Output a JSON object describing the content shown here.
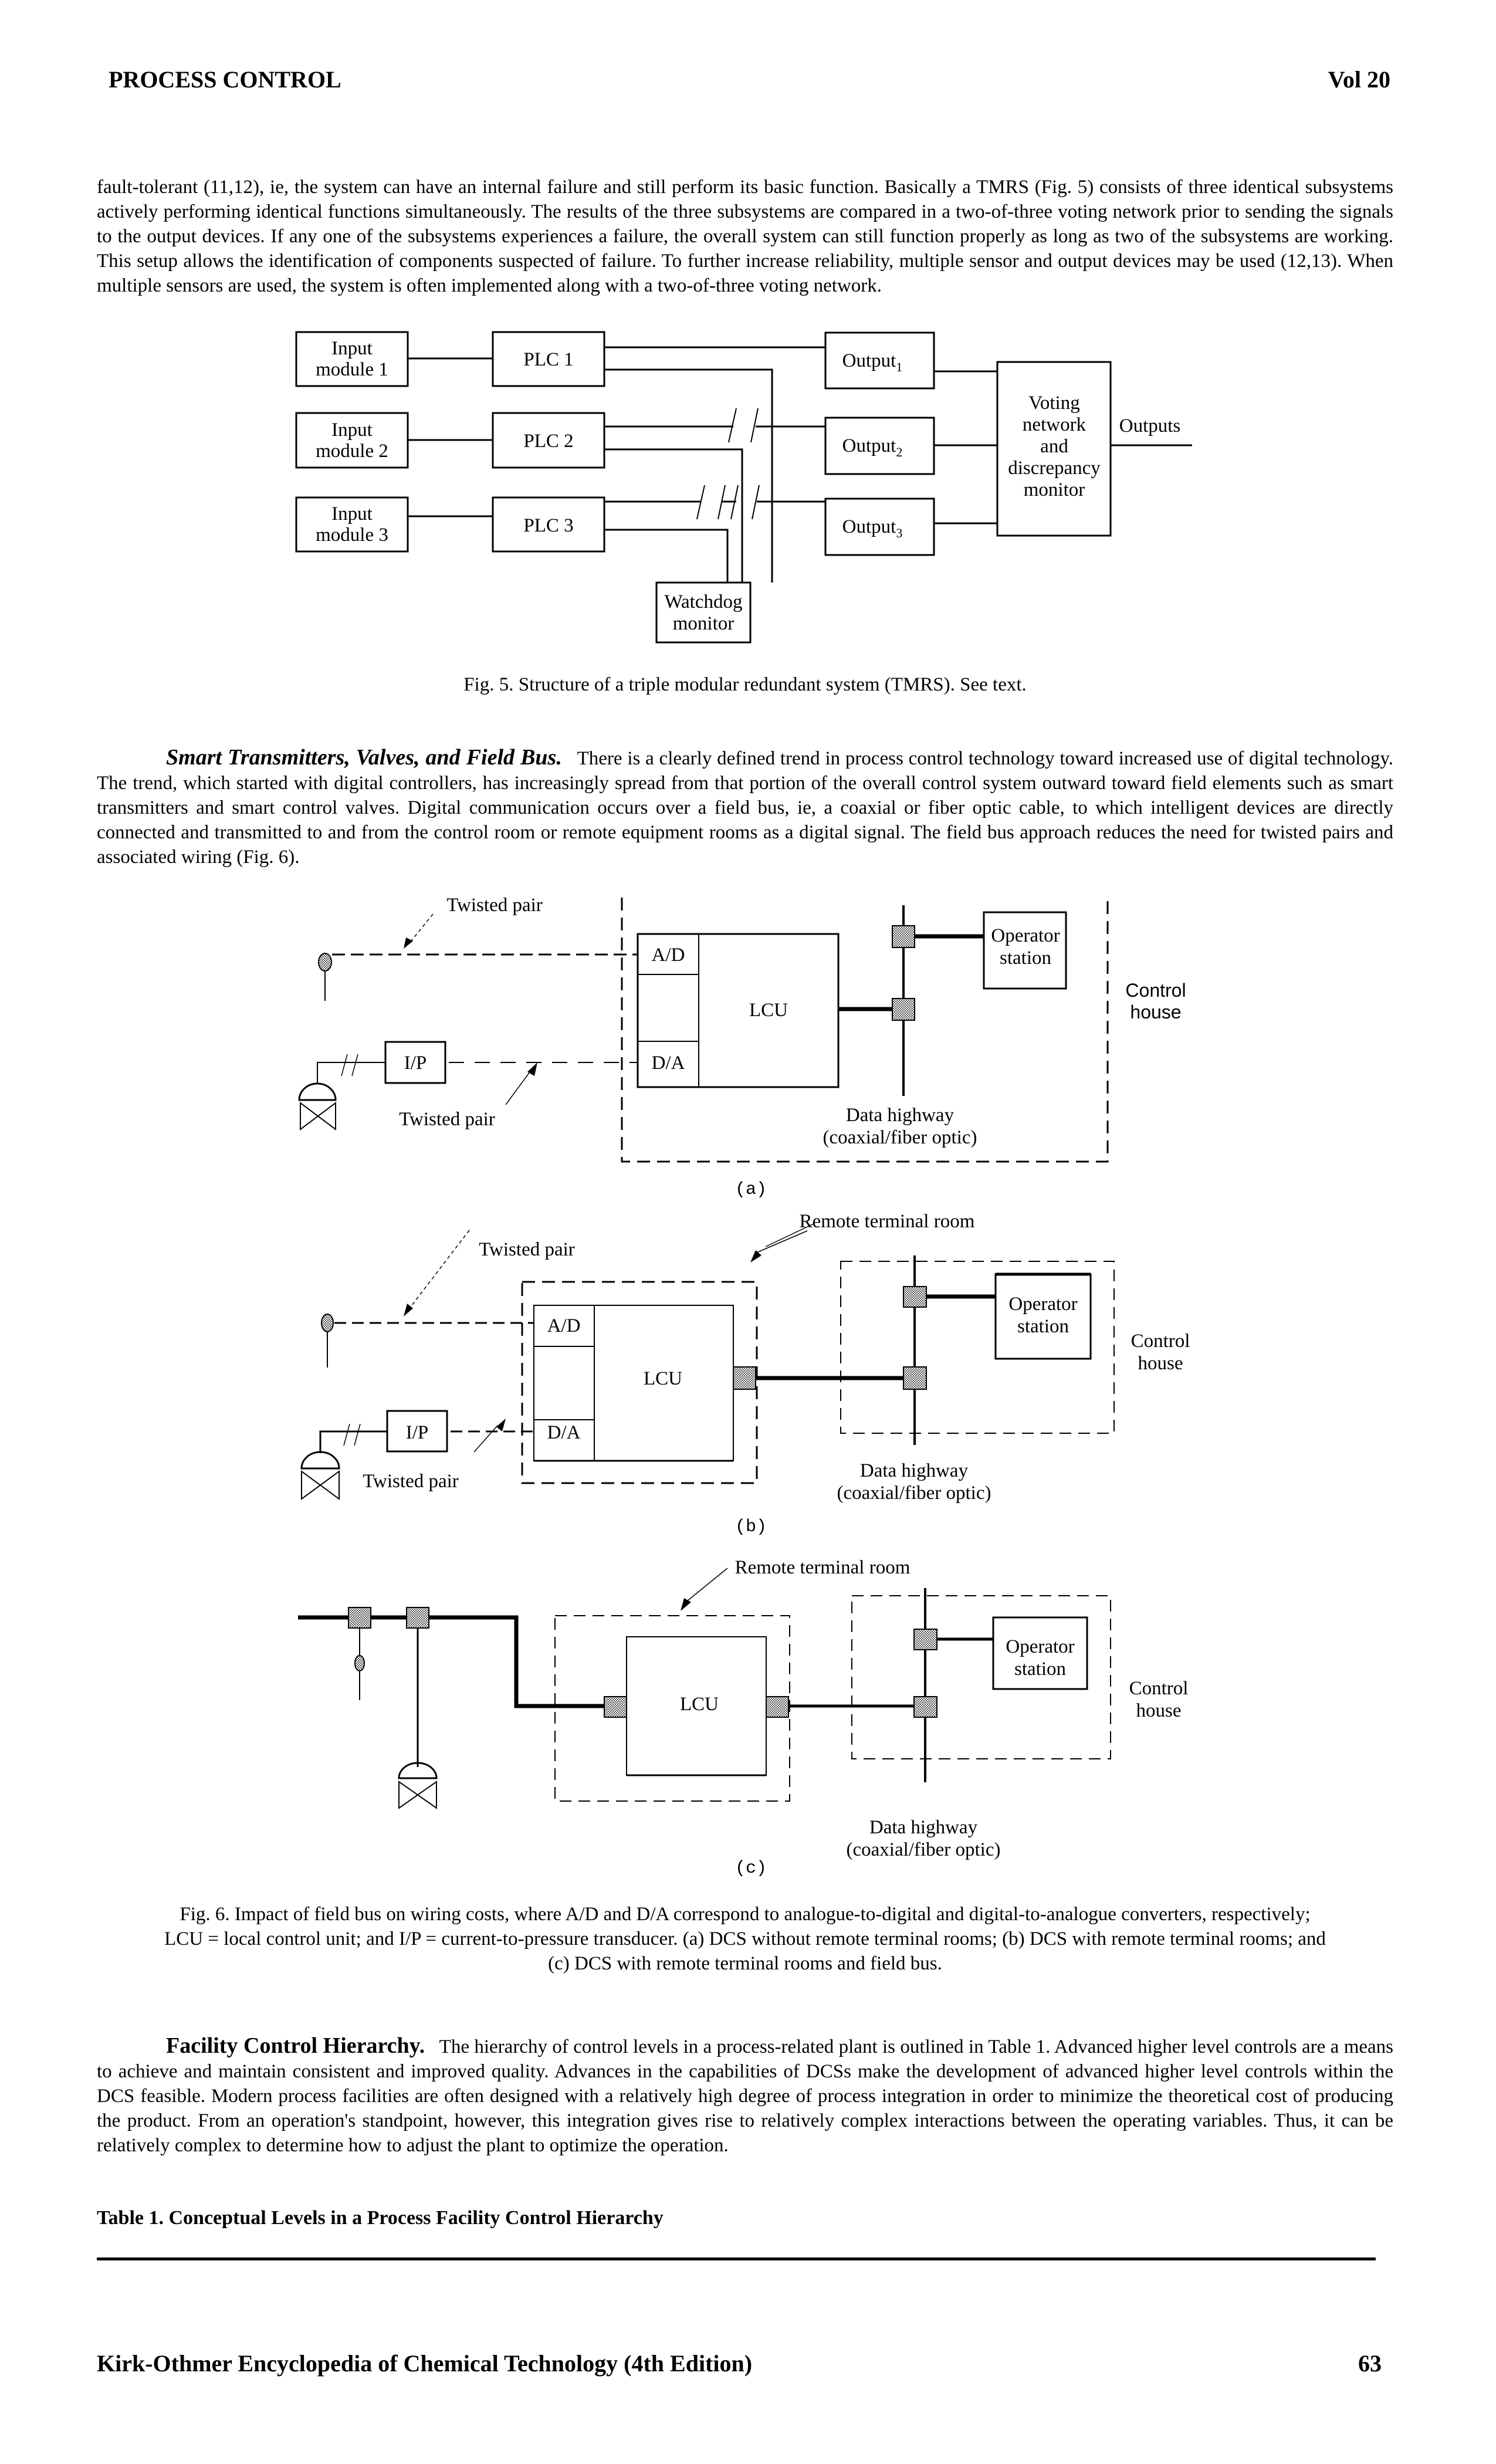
{
  "header": {
    "section": "PROCESS CONTROL",
    "volume": "Vol 20"
  },
  "paragraph1": "fault-tolerant (11,12), ie, the system can have an internal failure and still perform its basic function. Basically a TMRS (Fig. 5) consists of three identical subsystems actively performing identical functions simultaneously. The results of the three subsystems are compared in a two-of-three voting network prior to sending the signals to the output devices. If any one of the subsystems experiences a failure, the overall system can still function properly as long as two of the subsystems are working. This setup allows the identification of components suspected of failure. To further increase reliability, multiple sensor and output devices may be used (12,13). When multiple sensors are used, the system is often implemented along with a two-of-three voting network.",
  "fig5": {
    "input_modules": [
      {
        "line1": "Input",
        "line2": "module 1"
      },
      {
        "line1": "Input",
        "line2": "module 2"
      },
      {
        "line1": "Input",
        "line2": "module 3"
      }
    ],
    "plcs": [
      "PLC 1",
      "PLC 2",
      "PLC 3"
    ],
    "outputs": [
      {
        "label": "Output",
        "sub": "1"
      },
      {
        "label": "Output",
        "sub": "2"
      },
      {
        "label": "Output",
        "sub": "3"
      }
    ],
    "voting": [
      "Voting",
      "network",
      "and",
      "discrepancy",
      "monitor"
    ],
    "outputs_label": "Outputs",
    "watchdog": [
      "Watchdog",
      "monitor"
    ],
    "caption": "Fig. 5. Structure of a triple modular redundant system (TMRS). See text."
  },
  "section2": {
    "heading": "Smart Transmitters, Valves, and Field Bus.",
    "text": "There is a clearly defined trend in process control technology toward increased use of digital technology. The trend, which started with digital controllers, has increasingly spread from that portion of the overall control system outward toward field elements such as smart transmitters and smart control valves. Digital communication occurs over a field bus, ie, a coaxial or fiber optic cable, to which intelligent devices are directly connected and transmitted to and from the control room or remote equipment rooms as a digital signal. The field bus approach reduces the need for twisted pairs and associated wiring (Fig. 6)."
  },
  "fig6": {
    "twisted_pair": "Twisted pair",
    "ad": "A/D",
    "da": "D/A",
    "lcu": "LCU",
    "ip": "I/P",
    "operator_station": [
      "Operator",
      "station"
    ],
    "control_house": [
      "Control",
      "house"
    ],
    "data_highway": [
      "Data highway",
      "(coaxial/fiber optic)"
    ],
    "remote_terminal_room": "Remote terminal room",
    "panel_labels": [
      "(a)",
      "(b)",
      "(c)"
    ],
    "caption": [
      "Fig. 6. Impact of field bus on wiring costs, where A/D and D/A correspond to analogue-to-digital and digital-to-analogue converters, respectively;",
      "LCU = local control unit; and I/P = current-to-pressure transducer. (a) DCS without remote terminal rooms; (b) DCS with remote terminal rooms; and",
      "(c) DCS with remote terminal rooms and field bus."
    ]
  },
  "section3": {
    "heading": "Facility Control Hierarchy.",
    "text": "The hierarchy of control levels in a process-related plant is outlined in Table 1. Advanced higher level controls are a means to achieve and maintain consistent and improved quality. Advances in the capabilities of DCSs make the development of advanced higher level controls within the DCS feasible. Modern process facilities are often designed with a relatively high degree of process integration in order to minimize the theoretical cost of producing the product. From an operation's standpoint, however, this integration gives rise to relatively complex interactions between the operating variables. Thus, it can be relatively complex to determine how to adjust the plant to optimize the operation."
  },
  "table1": {
    "title": "Table 1. Conceptual Levels in a Process Facility Control Hierarchy"
  },
  "footer": {
    "book": "Kirk-Othmer Encyclopedia of Chemical Technology (4th Edition)",
    "page": "63"
  }
}
